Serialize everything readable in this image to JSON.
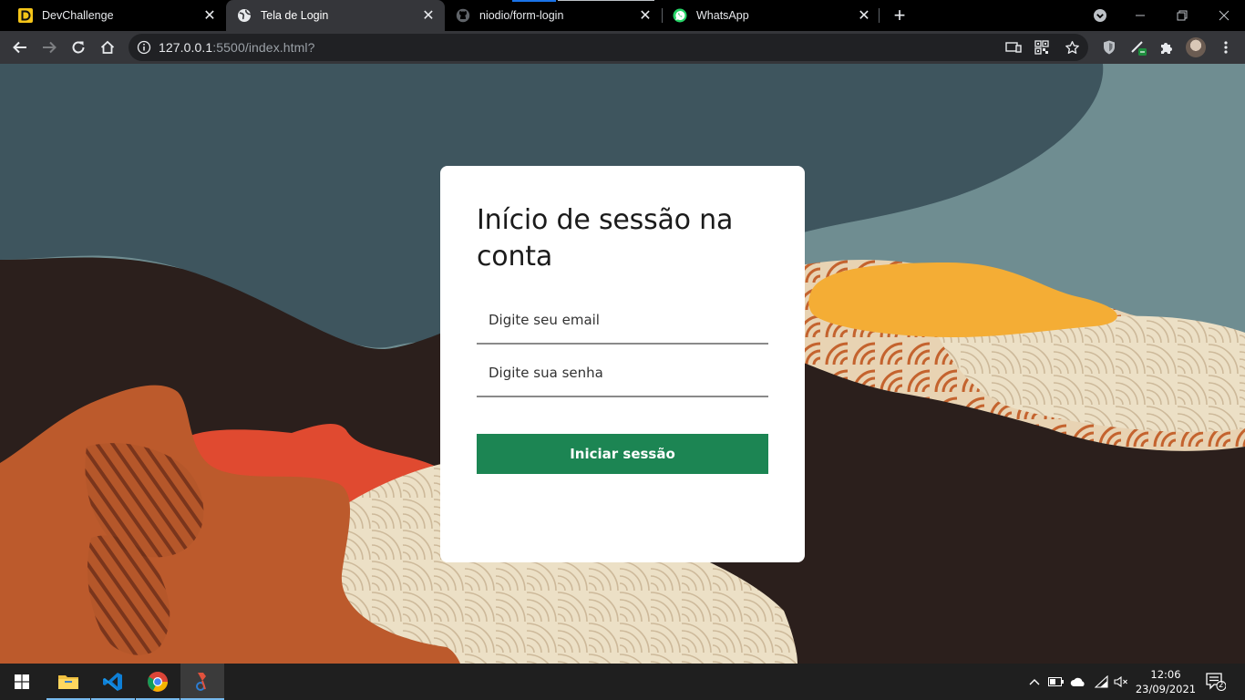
{
  "browser": {
    "tabs": [
      {
        "title": "DevChallenge",
        "favicon": "devchallenge-d-icon"
      },
      {
        "title": "Tela de Login",
        "favicon": "globe-icon",
        "active": true
      },
      {
        "title": "niodio/form-login",
        "favicon": "github-icon"
      },
      {
        "title": "WhatsApp",
        "favicon": "whatsapp-icon"
      }
    ],
    "close_glyph": "✕",
    "new_tab_glyph": "+",
    "url_host": "127.0.0.1",
    "url_rest": ":5500/index.html?"
  },
  "login": {
    "title": "Início de sessão na conta",
    "email_placeholder": "Digite seu email",
    "password_placeholder": "Digite sua senha",
    "submit_label": "Iniciar sessão",
    "button_color": "#1c8553"
  },
  "taskbar": {
    "time": "12:06",
    "date": "23/09/2021",
    "notification_count": "2"
  }
}
